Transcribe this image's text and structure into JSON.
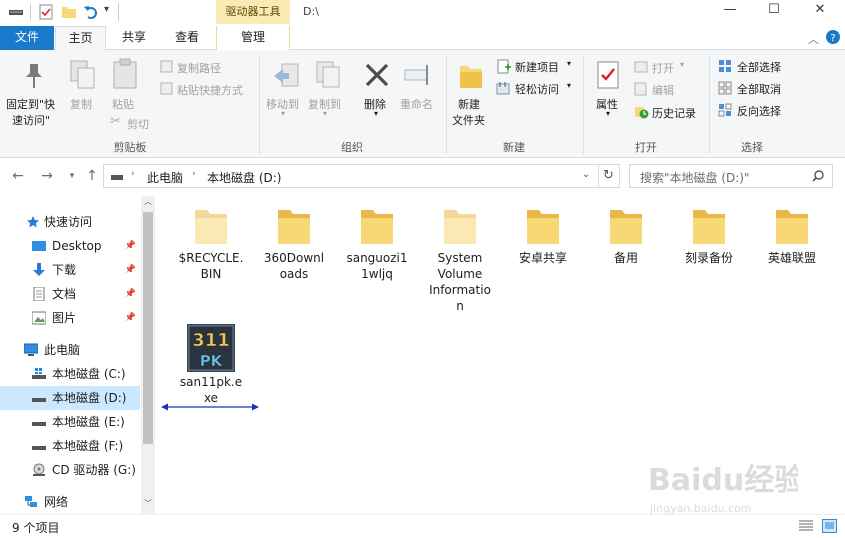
{
  "window": {
    "title": "D:\\",
    "context_tab_header": "驱动器工具",
    "buttons": {
      "minimize": "—",
      "maximize": "☐",
      "close": "✕"
    }
  },
  "tabs": [
    {
      "label": "文件"
    },
    {
      "label": "主页"
    },
    {
      "label": "共享"
    },
    {
      "label": "查看"
    },
    {
      "label": "管理"
    }
  ],
  "ribbon": {
    "clipboard": {
      "group": "剪贴板",
      "pin_l1": "固定到\"快",
      "pin_l2": "速访问\"",
      "copy": "复制",
      "paste": "粘贴",
      "copy_path": "复制路径",
      "paste_shortcut": "粘贴快捷方式",
      "cut": "剪切"
    },
    "organize": {
      "group": "组织",
      "move_to": "移动到",
      "copy_to": "复制到",
      "delete": "删除",
      "rename": "重命名"
    },
    "new": {
      "group": "新建",
      "new_folder_l1": "新建",
      "new_folder_l2": "文件夹",
      "new_item": "新建项目",
      "easy_access": "轻松访问"
    },
    "open": {
      "group": "打开",
      "properties": "属性",
      "open": "打开",
      "edit": "编辑",
      "history": "历史记录"
    },
    "select": {
      "group": "选择",
      "select_all": "全部选择",
      "select_none": "全部取消",
      "invert": "反向选择"
    }
  },
  "address": {
    "crumbs": [
      "此电脑",
      "本地磁盘 (D:)"
    ],
    "search_placeholder": "搜索\"本地磁盘 (D:)\""
  },
  "navpane": {
    "quick_access": "快速访问",
    "items": [
      {
        "label": "Desktop",
        "pinned": true
      },
      {
        "label": "下载",
        "pinned": true
      },
      {
        "label": "文档",
        "pinned": true
      },
      {
        "label": "图片",
        "pinned": true
      }
    ],
    "this_pc": "此电脑",
    "drives": [
      {
        "label": "本地磁盘 (C:)"
      },
      {
        "label": "本地磁盘 (D:)",
        "selected": true
      },
      {
        "label": "本地磁盘 (E:)"
      },
      {
        "label": "本地磁盘 (F:)"
      },
      {
        "label": "CD 驱动器 (G:)"
      }
    ],
    "network": "网络"
  },
  "files": [
    {
      "name": "$RECYCLE.BIN",
      "lines": [
        "$RECYCLE.",
        "BIN"
      ],
      "faded": true
    },
    {
      "name": "360Downloads",
      "lines": [
        "360Downl",
        "oads"
      ]
    },
    {
      "name": "sanguozi11wljq",
      "lines": [
        "sanguozi1",
        "1wljq"
      ]
    },
    {
      "name": "System Volume Information",
      "lines": [
        "System",
        "Volume",
        "Informatio",
        "n"
      ],
      "faded": true
    },
    {
      "name": "安卓共享",
      "lines": [
        "安卓共享"
      ]
    },
    {
      "name": "备用",
      "lines": [
        "备用"
      ]
    },
    {
      "name": "刻录备份",
      "lines": [
        "刻录备份"
      ]
    },
    {
      "name": "英雄联盟",
      "lines": [
        "英雄联盟"
      ]
    },
    {
      "name": "san11pk.exe",
      "lines": [
        "san11pk.e",
        "xe"
      ],
      "exe_icon_text": [
        "311",
        "PK"
      ]
    }
  ],
  "status": {
    "count": "9 个项目"
  },
  "watermark": {
    "text": "Baidu经验",
    "url": "jingyan.baidu.com"
  },
  "colors": {
    "accent": "#1979ca",
    "folder": "#f8d775",
    "folder_dark": "#e8b94a",
    "selection": "#cce8ff",
    "annotation_arrow": "#1a33b8"
  }
}
